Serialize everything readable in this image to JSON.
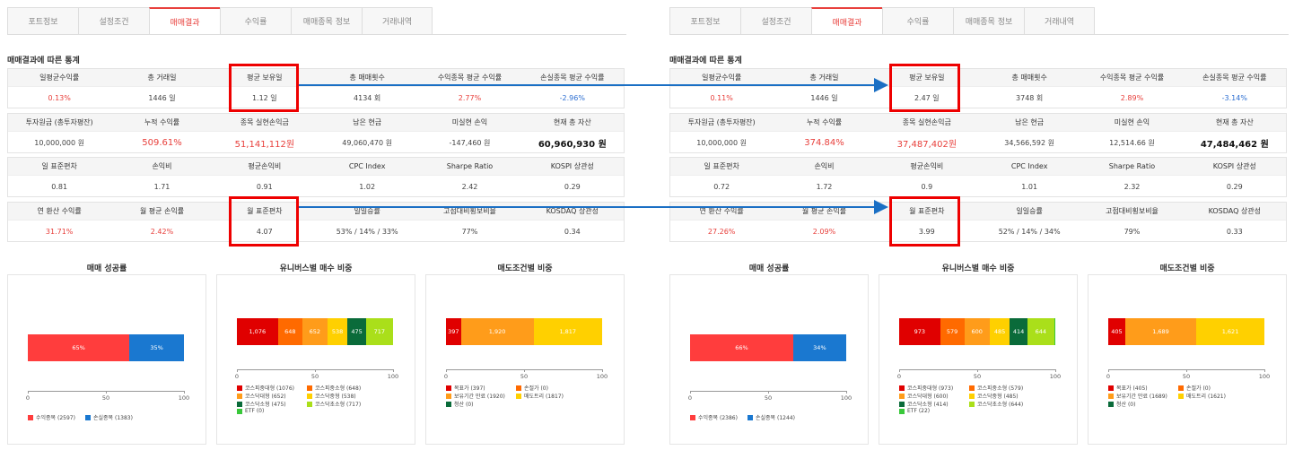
{
  "tabs": [
    "포트정보",
    "설정조건",
    "매매결과",
    "수익률",
    "매매종목 정보",
    "거래내역"
  ],
  "active_tab": 2,
  "section_title": "매매결과에 따른 통계",
  "row_headers": [
    [
      "일평균수익률",
      "총 거래일",
      "평균 보유일",
      "총 매매횟수",
      "수익종목 평균 수익률",
      "손실종목 평균 수익률"
    ],
    [
      "투자원금 (총투자평잔)",
      "누적 수익률",
      "종목 실현손익금",
      "남은 현금",
      "미실현 손익",
      "현재 총 자산"
    ],
    [
      "일 표준편차",
      "손익비",
      "평균손익비",
      "CPC Index",
      "Sharpe Ratio",
      "KOSPI 상관성"
    ],
    [
      "연 환산 수익률",
      "월 평균 손익률",
      "월 표준편차",
      "일일승률",
      "고점대비횡보비율",
      "KOSDAQ 상관성"
    ]
  ],
  "chart_titles": [
    "매매 성공률",
    "유니버스별 매수 비중",
    "매도조건별 비중"
  ],
  "axis_ticks": [
    "0",
    "50",
    "100"
  ],
  "colors": {
    "accent": "#e8403c",
    "blue": "#2d6fd2",
    "highlight": "#e00000",
    "arrow": "#1a6fc4"
  },
  "left": {
    "values": [
      [
        "0.13%",
        "1446 일",
        "1.12 일",
        "4134 회",
        "2.77%",
        "-2.96%"
      ],
      [
        "10,000,000 원",
        "509.61%",
        "51,141,112원",
        "49,060,470 원",
        "-147,460 원",
        "60,960,930 원"
      ],
      [
        "0.81",
        "1.71",
        "0.91",
        "1.02",
        "2.42",
        "0.29"
      ],
      [
        "31.71%",
        "2.42%",
        "4.07",
        "53% / 14% / 33%",
        "77%",
        "0.34"
      ]
    ],
    "success": {
      "segments": [
        {
          "label": "65%",
          "value": 65
        },
        {
          "label": "35%",
          "value": 35
        }
      ],
      "legend": [
        "수익종목 (2597)",
        "손실종목 (1383)"
      ]
    },
    "universe": {
      "segments": [
        {
          "label": "1,076",
          "value": 1076
        },
        {
          "label": "648",
          "value": 648
        },
        {
          "label": "652",
          "value": 652
        },
        {
          "label": "538",
          "value": 538
        },
        {
          "label": "475",
          "value": 475
        },
        {
          "label": "717",
          "value": 717
        }
      ],
      "legend": [
        "코스피중대형 (1076)",
        "코스피중소형 (648)",
        "코스닥대형 (652)",
        "코스닥중형 (538)",
        "코스닥소형 (475)",
        "코스닥초소형 (717)",
        "ETF (0)"
      ]
    },
    "sell": {
      "segments": [
        {
          "label": "397",
          "value": 397
        },
        {
          "label": "1,920",
          "value": 1920
        },
        {
          "label": "1,817",
          "value": 1817
        }
      ],
      "legend": [
        "목표가 (397)",
        "손절가 (0)",
        "보유기간 만료 (1920)",
        "매도트리 (1817)",
        "청산 (0)"
      ]
    }
  },
  "right": {
    "values": [
      [
        "0.11%",
        "1446 일",
        "2.47 일",
        "3748 회",
        "2.89%",
        "-3.14%"
      ],
      [
        "10,000,000 원",
        "374.84%",
        "37,487,402원",
        "34,566,592 원",
        "12,514.66 원",
        "47,484,462 원"
      ],
      [
        "0.72",
        "1.72",
        "0.9",
        "1.01",
        "2.32",
        "0.29"
      ],
      [
        "27.26%",
        "2.09%",
        "3.99",
        "52% / 14% / 34%",
        "79%",
        "0.33"
      ]
    ],
    "success": {
      "segments": [
        {
          "label": "66%",
          "value": 66
        },
        {
          "label": "34%",
          "value": 34
        }
      ],
      "legend": [
        "수익종목 (2386)",
        "손실종목 (1244)"
      ]
    },
    "universe": {
      "segments": [
        {
          "label": "973",
          "value": 973
        },
        {
          "label": "579",
          "value": 579
        },
        {
          "label": "600",
          "value": 600
        },
        {
          "label": "485",
          "value": 485
        },
        {
          "label": "414",
          "value": 414
        },
        {
          "label": "644",
          "value": 644
        },
        {
          "label": "",
          "value": 22
        }
      ],
      "legend": [
        "코스피중대형 (973)",
        "코스피중소형 (579)",
        "코스닥대형 (600)",
        "코스닥중형 (485)",
        "코스닥소형 (414)",
        "코스닥초소형 (644)",
        "ETF (22)"
      ]
    },
    "sell": {
      "segments": [
        {
          "label": "405",
          "value": 405
        },
        {
          "label": "1,689",
          "value": 1689
        },
        {
          "label": "1,621",
          "value": 1621
        }
      ],
      "legend": [
        "목표가 (405)",
        "손절가 (0)",
        "보유기간 만료 (1689)",
        "매도트리 (1621)",
        "청산 (0)"
      ]
    }
  }
}
